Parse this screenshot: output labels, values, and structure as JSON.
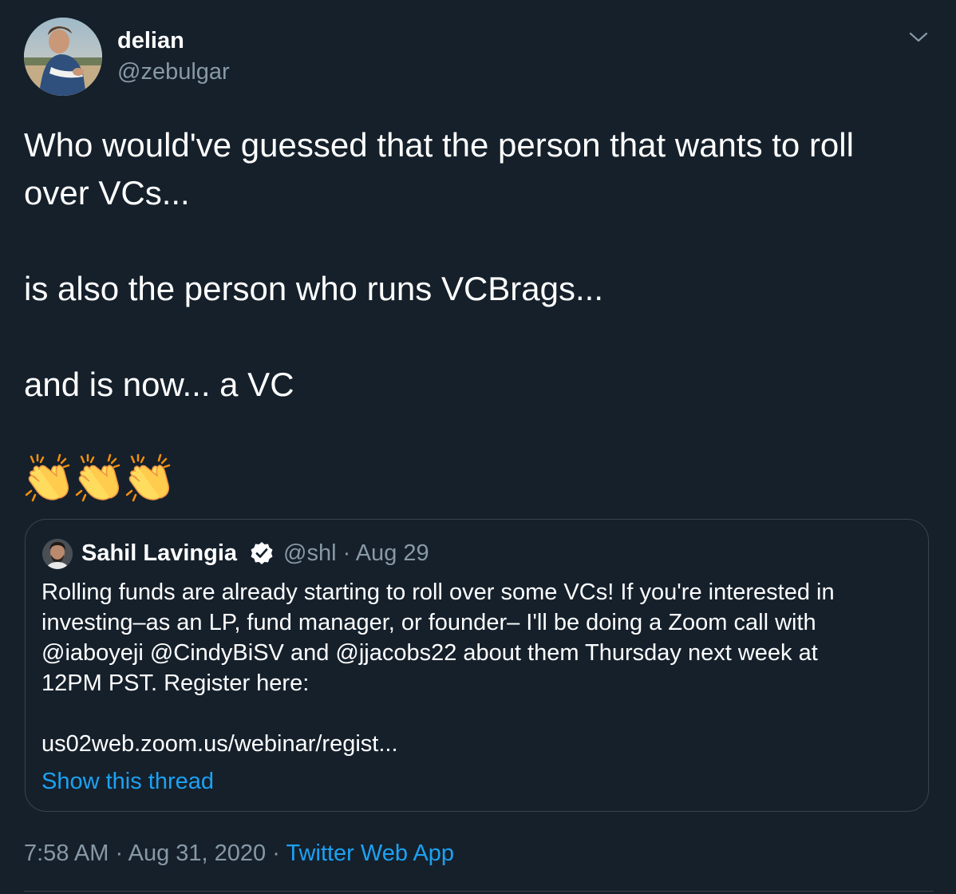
{
  "tweet": {
    "author": {
      "name": "delian",
      "handle": "@zebulgar"
    },
    "text_lines": [
      "Who would've guessed that the person that wants to roll",
      "over VCs...",
      "",
      "is also the person who runs VCBrags...",
      "",
      "and is now... a VC"
    ],
    "emoji": [
      "clapping-hands",
      "clapping-hands",
      "clapping-hands"
    ],
    "timestamp": {
      "time": "7:58 AM",
      "date": "Aug 31, 2020",
      "separator": "·",
      "source": "Twitter Web App"
    }
  },
  "quoted_tweet": {
    "author": {
      "name": "Sahil Lavingia",
      "verified": true,
      "handle": "@shl",
      "date": "Aug 29",
      "separator": "·"
    },
    "text_lines": [
      "Rolling funds are already starting to roll over some VCs! If you're interested in",
      "investing–as an LP, fund manager, or founder– I'll be doing a Zoom call with",
      "@iaboyeji @CindyBiSV and @jjacobs22 about them Thursday next week at",
      "12PM PST. Register here:",
      "",
      "us02web.zoom.us/webinar/regist..."
    ],
    "show_thread_label": "Show this thread"
  },
  "colors": {
    "background": "#15202b",
    "text_primary": "#ffffff",
    "text_secondary": "#8899a6",
    "link": "#1da1f2",
    "border": "#38444d",
    "verified_badge": "#ffffff"
  },
  "icons": {
    "menu": "chevron-down-icon",
    "verified": "verified-badge-icon",
    "emoji": "clapping-hands-icon"
  }
}
